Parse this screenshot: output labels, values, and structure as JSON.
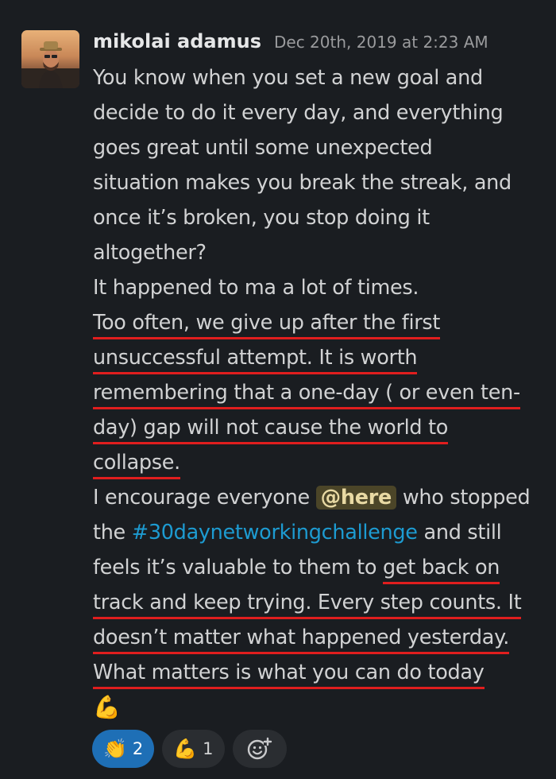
{
  "message": {
    "author": "mikolai adamus",
    "timestamp": "Dec 20th, 2019 at 2:23 AM",
    "lines": [
      "You know when you set a new goal and",
      "decide to do it every day, and everything",
      "goes great until some unexpected",
      "situation makes you break the streak, and",
      "once it’s broken, you stop doing it",
      "altogether?",
      "It happened to ma a lot of times.",
      "Too often, we give up after the first",
      "unsuccessful attempt. It is worth",
      "remembering that a one-day ( or even ten-",
      "day) gap will not cause the world to",
      "collapse."
    ],
    "para2": {
      "pre": "I encourage everyone",
      "mention": "@here",
      "post": "who stopped",
      "the": "the",
      "channel": "#30daynetworkingchallenge",
      "after_channel": "and still",
      "l3_plain": "feels it’s valuable to them to",
      "l3_under": "get back on",
      "l4": "track and keep trying. Every step counts. It",
      "l5": "doesn’t matter what happened yesterday.",
      "l6": "What matters is what you can do today",
      "emoji": "💪"
    }
  },
  "reactions": [
    {
      "emoji": "👏",
      "count": "2",
      "active": true
    },
    {
      "emoji": "💪",
      "count": "1",
      "active": false
    }
  ],
  "add_reaction_icon": "add-emoji-icon",
  "colors": {
    "background": "#1a1d21",
    "text": "#d1d2d3",
    "underline": "#e01e1e",
    "link": "#1d9bd1",
    "mention_bg": "#4b4528",
    "active_reaction": "#1e6fb6"
  }
}
